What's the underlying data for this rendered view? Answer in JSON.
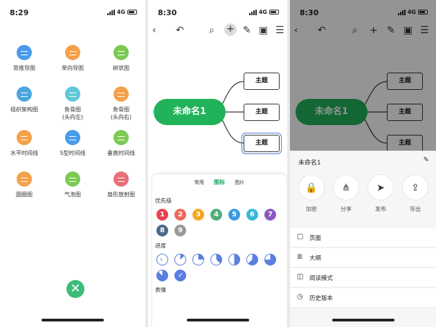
{
  "panels": {
    "p1": {
      "time": "8:29",
      "network": "4G",
      "templates": [
        {
          "label": "思维导图",
          "color": "#4a9bea",
          "icon": "mindmap-icon"
        },
        {
          "label": "单向导图",
          "color": "#f5a04a",
          "icon": "one-way-map-icon"
        },
        {
          "label": "树状图",
          "color": "#7cca55",
          "icon": "tree-icon"
        },
        {
          "label": "组织架构图",
          "color": "#4aa5e0",
          "icon": "org-chart-icon"
        },
        {
          "label": "鱼骨图\n(头向左)",
          "color": "#5fc7d8",
          "icon": "fishbone-left-icon"
        },
        {
          "label": "鱼骨图\n(头向右)",
          "color": "#f5a04a",
          "icon": "fishbone-right-icon"
        },
        {
          "label": "水平时间线",
          "color": "#f5a04a",
          "icon": "horizontal-timeline-icon"
        },
        {
          "label": "S型时间线",
          "color": "#4a9bea",
          "icon": "s-timeline-icon"
        },
        {
          "label": "垂直时间线",
          "color": "#7cca55",
          "icon": "vertical-timeline-icon"
        },
        {
          "label": "圆圈图",
          "color": "#f5a04a",
          "icon": "circle-map-icon"
        },
        {
          "label": "气泡图",
          "color": "#7cca55",
          "icon": "bubble-map-icon"
        },
        {
          "label": "扇形放射图",
          "color": "#e8707a",
          "icon": "sector-radial-icon"
        }
      ],
      "close_label": "✕"
    },
    "p2": {
      "time": "8:30",
      "network": "4G",
      "toolbar": [
        "back-icon",
        "undo-icon",
        "search-icon",
        "add-icon",
        "style-brush-icon",
        "save-icon",
        "menu-icon"
      ],
      "root_label": "未命名1",
      "topics": [
        "主题",
        "主题",
        "主题"
      ],
      "sheet": {
        "tabs": [
          "常用",
          "图标",
          "图片"
        ],
        "active_tab": "图标",
        "priority_label": "优先级",
        "priorities": [
          {
            "n": "1",
            "color": "#e8414f"
          },
          {
            "n": "2",
            "color": "#f0685b"
          },
          {
            "n": "3",
            "color": "#f5a623"
          },
          {
            "n": "4",
            "color": "#4fb07a"
          },
          {
            "n": "5",
            "color": "#3a9be0"
          },
          {
            "n": "6",
            "color": "#3ab7d8"
          },
          {
            "n": "7",
            "color": "#8a5ac0"
          },
          {
            "n": "8",
            "color": "#4a6a8a"
          },
          {
            "n": "9",
            "color": "#9a9a9a"
          }
        ],
        "progress_label": "进度",
        "progress_levels": [
          0,
          0.125,
          0.25,
          0.375,
          0.5,
          0.625,
          0.75,
          0.875,
          1
        ],
        "emoji_label": "表情"
      }
    },
    "p3": {
      "time": "8:30",
      "network": "4G",
      "root_label": "未命名1",
      "topics": [
        "主题",
        "主题",
        "主题"
      ],
      "doc_title": "未命名1",
      "actions": [
        {
          "label": "加密",
          "icon": "lock-icon",
          "glyph": "🔒"
        },
        {
          "label": "分享",
          "icon": "share-icon",
          "glyph": "⋔"
        },
        {
          "label": "发布",
          "icon": "publish-icon",
          "glyph": "➤"
        },
        {
          "label": "导出",
          "icon": "export-icon",
          "glyph": "⇪"
        }
      ],
      "menu": [
        {
          "label": "页面",
          "icon": "page-icon",
          "glyph": "▢"
        },
        {
          "label": "大纲",
          "icon": "outline-icon",
          "glyph": "≣"
        },
        {
          "label": "阅读模式",
          "icon": "reading-mode-icon",
          "glyph": "◫"
        },
        {
          "label": "历史版本",
          "icon": "history-icon",
          "glyph": "◷"
        }
      ]
    }
  }
}
